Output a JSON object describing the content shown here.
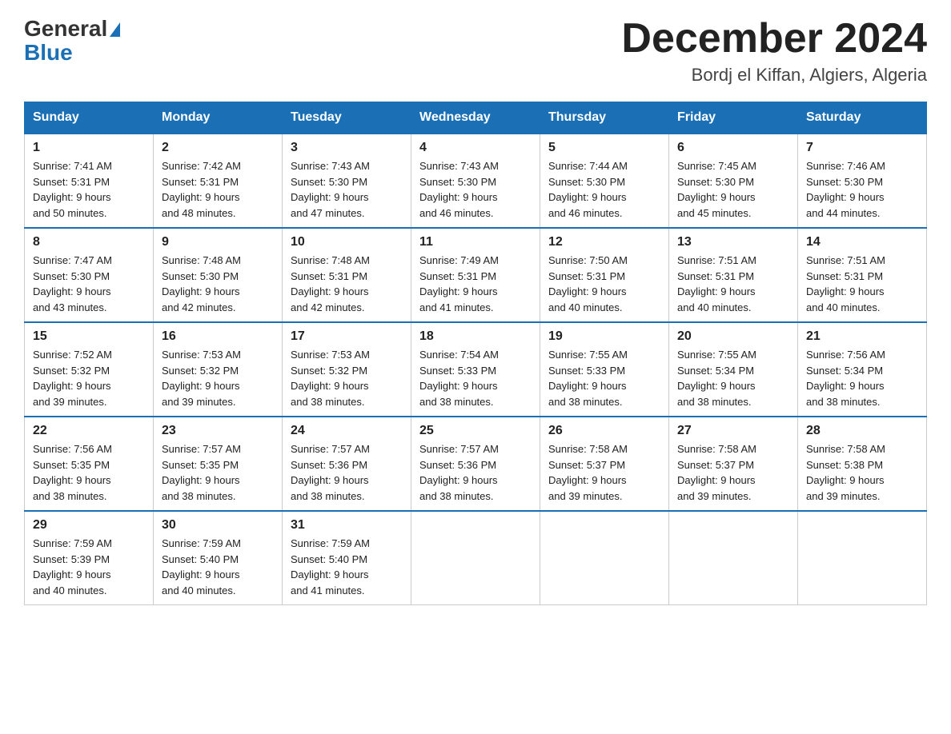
{
  "logo": {
    "general": "General",
    "blue": "Blue"
  },
  "title": "December 2024",
  "location": "Bordj el Kiffan, Algiers, Algeria",
  "days_of_week": [
    "Sunday",
    "Monday",
    "Tuesday",
    "Wednesday",
    "Thursday",
    "Friday",
    "Saturday"
  ],
  "weeks": [
    [
      {
        "day": "1",
        "sunrise": "7:41 AM",
        "sunset": "5:31 PM",
        "daylight": "9 hours and 50 minutes."
      },
      {
        "day": "2",
        "sunrise": "7:42 AM",
        "sunset": "5:31 PM",
        "daylight": "9 hours and 48 minutes."
      },
      {
        "day": "3",
        "sunrise": "7:43 AM",
        "sunset": "5:30 PM",
        "daylight": "9 hours and 47 minutes."
      },
      {
        "day": "4",
        "sunrise": "7:43 AM",
        "sunset": "5:30 PM",
        "daylight": "9 hours and 46 minutes."
      },
      {
        "day": "5",
        "sunrise": "7:44 AM",
        "sunset": "5:30 PM",
        "daylight": "9 hours and 46 minutes."
      },
      {
        "day": "6",
        "sunrise": "7:45 AM",
        "sunset": "5:30 PM",
        "daylight": "9 hours and 45 minutes."
      },
      {
        "day": "7",
        "sunrise": "7:46 AM",
        "sunset": "5:30 PM",
        "daylight": "9 hours and 44 minutes."
      }
    ],
    [
      {
        "day": "8",
        "sunrise": "7:47 AM",
        "sunset": "5:30 PM",
        "daylight": "9 hours and 43 minutes."
      },
      {
        "day": "9",
        "sunrise": "7:48 AM",
        "sunset": "5:30 PM",
        "daylight": "9 hours and 42 minutes."
      },
      {
        "day": "10",
        "sunrise": "7:48 AM",
        "sunset": "5:31 PM",
        "daylight": "9 hours and 42 minutes."
      },
      {
        "day": "11",
        "sunrise": "7:49 AM",
        "sunset": "5:31 PM",
        "daylight": "9 hours and 41 minutes."
      },
      {
        "day": "12",
        "sunrise": "7:50 AM",
        "sunset": "5:31 PM",
        "daylight": "9 hours and 40 minutes."
      },
      {
        "day": "13",
        "sunrise": "7:51 AM",
        "sunset": "5:31 PM",
        "daylight": "9 hours and 40 minutes."
      },
      {
        "day": "14",
        "sunrise": "7:51 AM",
        "sunset": "5:31 PM",
        "daylight": "9 hours and 40 minutes."
      }
    ],
    [
      {
        "day": "15",
        "sunrise": "7:52 AM",
        "sunset": "5:32 PM",
        "daylight": "9 hours and 39 minutes."
      },
      {
        "day": "16",
        "sunrise": "7:53 AM",
        "sunset": "5:32 PM",
        "daylight": "9 hours and 39 minutes."
      },
      {
        "day": "17",
        "sunrise": "7:53 AM",
        "sunset": "5:32 PM",
        "daylight": "9 hours and 38 minutes."
      },
      {
        "day": "18",
        "sunrise": "7:54 AM",
        "sunset": "5:33 PM",
        "daylight": "9 hours and 38 minutes."
      },
      {
        "day": "19",
        "sunrise": "7:55 AM",
        "sunset": "5:33 PM",
        "daylight": "9 hours and 38 minutes."
      },
      {
        "day": "20",
        "sunrise": "7:55 AM",
        "sunset": "5:34 PM",
        "daylight": "9 hours and 38 minutes."
      },
      {
        "day": "21",
        "sunrise": "7:56 AM",
        "sunset": "5:34 PM",
        "daylight": "9 hours and 38 minutes."
      }
    ],
    [
      {
        "day": "22",
        "sunrise": "7:56 AM",
        "sunset": "5:35 PM",
        "daylight": "9 hours and 38 minutes."
      },
      {
        "day": "23",
        "sunrise": "7:57 AM",
        "sunset": "5:35 PM",
        "daylight": "9 hours and 38 minutes."
      },
      {
        "day": "24",
        "sunrise": "7:57 AM",
        "sunset": "5:36 PM",
        "daylight": "9 hours and 38 minutes."
      },
      {
        "day": "25",
        "sunrise": "7:57 AM",
        "sunset": "5:36 PM",
        "daylight": "9 hours and 38 minutes."
      },
      {
        "day": "26",
        "sunrise": "7:58 AM",
        "sunset": "5:37 PM",
        "daylight": "9 hours and 39 minutes."
      },
      {
        "day": "27",
        "sunrise": "7:58 AM",
        "sunset": "5:37 PM",
        "daylight": "9 hours and 39 minutes."
      },
      {
        "day": "28",
        "sunrise": "7:58 AM",
        "sunset": "5:38 PM",
        "daylight": "9 hours and 39 minutes."
      }
    ],
    [
      {
        "day": "29",
        "sunrise": "7:59 AM",
        "sunset": "5:39 PM",
        "daylight": "9 hours and 40 minutes."
      },
      {
        "day": "30",
        "sunrise": "7:59 AM",
        "sunset": "5:40 PM",
        "daylight": "9 hours and 40 minutes."
      },
      {
        "day": "31",
        "sunrise": "7:59 AM",
        "sunset": "5:40 PM",
        "daylight": "9 hours and 41 minutes."
      },
      null,
      null,
      null,
      null
    ]
  ],
  "labels": {
    "sunrise": "Sunrise:",
    "sunset": "Sunset:",
    "daylight": "Daylight:"
  }
}
